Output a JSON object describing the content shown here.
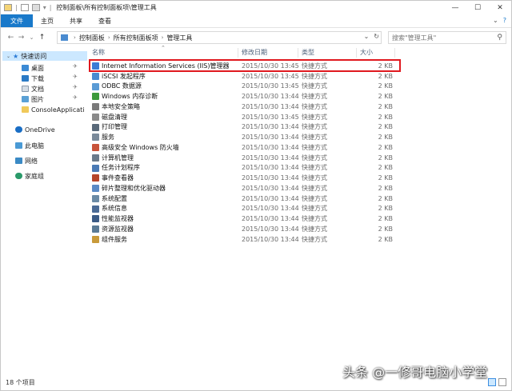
{
  "window": {
    "title": "控制面板\\所有控制面板项\\管理工具",
    "controls": {
      "minimize": "—",
      "maximize": "☐",
      "close": "✕"
    }
  },
  "ribbon": {
    "tabs": [
      "文件",
      "主页",
      "共享",
      "查看"
    ],
    "expand_icon": "chevron-down-icon",
    "help_icon": "help-icon"
  },
  "address": {
    "crumbs": [
      "控制面板",
      "所有控制面板项",
      "管理工具"
    ],
    "search_placeholder": "搜索\"管理工具\""
  },
  "nav": {
    "quick_access": "快速访问",
    "items": [
      {
        "label": "桌面",
        "pinned": true,
        "icon": "desktop-icon"
      },
      {
        "label": "下载",
        "pinned": true,
        "icon": "download-icon"
      },
      {
        "label": "文档",
        "pinned": true,
        "icon": "document-icon"
      },
      {
        "label": "图片",
        "pinned": true,
        "icon": "picture-icon"
      },
      {
        "label": "ConsoleApplicati",
        "pinned": false,
        "icon": "folder-icon"
      }
    ],
    "onedrive": "OneDrive",
    "this_pc": "此电脑",
    "network": "网络",
    "homegroup": "家庭组"
  },
  "columns": {
    "name": "名称",
    "date": "修改日期",
    "type": "类型",
    "size": "大小"
  },
  "files": [
    {
      "name": "Internet Information Services (IIS)管理器",
      "date": "2015/10/30 13:45",
      "type": "快捷方式",
      "size": "2 KB",
      "icon_color": "#3a7bd5"
    },
    {
      "name": "iSCSI 发起程序",
      "date": "2015/10/30 13:45",
      "type": "快捷方式",
      "size": "2 KB",
      "icon_color": "#4a8bd0"
    },
    {
      "name": "ODBC 数据源",
      "date": "2015/10/30 13:45",
      "type": "快捷方式",
      "size": "2 KB",
      "icon_color": "#5a9bd5"
    },
    {
      "name": "Windows 内存诊断",
      "date": "2015/10/30 13:44",
      "type": "快捷方式",
      "size": "2 KB",
      "icon_color": "#3c9a3c"
    },
    {
      "name": "本地安全策略",
      "date": "2015/10/30 13:44",
      "type": "快捷方式",
      "size": "2 KB",
      "icon_color": "#7a7a7a"
    },
    {
      "name": "磁盘清理",
      "date": "2015/10/30 13:45",
      "type": "快捷方式",
      "size": "2 KB",
      "icon_color": "#8a8a8a"
    },
    {
      "name": "打印管理",
      "date": "2015/10/30 13:44",
      "type": "快捷方式",
      "size": "2 KB",
      "icon_color": "#5a6a7a"
    },
    {
      "name": "服务",
      "date": "2015/10/30 13:44",
      "type": "快捷方式",
      "size": "2 KB",
      "icon_color": "#7a8a9a"
    },
    {
      "name": "高级安全 Windows 防火墙",
      "date": "2015/10/30 13:44",
      "type": "快捷方式",
      "size": "2 KB",
      "icon_color": "#c8533a"
    },
    {
      "name": "计算机管理",
      "date": "2015/10/30 13:44",
      "type": "快捷方式",
      "size": "2 KB",
      "icon_color": "#6a7a8a"
    },
    {
      "name": "任务计划程序",
      "date": "2015/10/30 13:44",
      "type": "快捷方式",
      "size": "2 KB",
      "icon_color": "#4a7ab5"
    },
    {
      "name": "事件查看器",
      "date": "2015/10/30 13:44",
      "type": "快捷方式",
      "size": "2 KB",
      "icon_color": "#b5452a"
    },
    {
      "name": "碎片整理和优化驱动器",
      "date": "2015/10/30 13:44",
      "type": "快捷方式",
      "size": "2 KB",
      "icon_color": "#5a8ac5"
    },
    {
      "name": "系统配置",
      "date": "2015/10/30 13:44",
      "type": "快捷方式",
      "size": "2 KB",
      "icon_color": "#6a8aa5"
    },
    {
      "name": "系统信息",
      "date": "2015/10/30 13:44",
      "type": "快捷方式",
      "size": "2 KB",
      "icon_color": "#4a6a95"
    },
    {
      "name": "性能监视器",
      "date": "2015/10/30 13:44",
      "type": "快捷方式",
      "size": "2 KB",
      "icon_color": "#3a5a85"
    },
    {
      "name": "资源监视器",
      "date": "2015/10/30 13:44",
      "type": "快捷方式",
      "size": "2 KB",
      "icon_color": "#5a7a95"
    },
    {
      "name": "组件服务",
      "date": "2015/10/30 13:44",
      "type": "快捷方式",
      "size": "2 KB",
      "icon_color": "#c89a3a"
    }
  ],
  "status": {
    "count": "18 个项目"
  },
  "watermark": "头条 @一修哥电脑小学堂",
  "colors": {
    "accent": "#1979ca",
    "highlight_border": "#e0191f",
    "quick_access_bg": "#cce8ff"
  }
}
